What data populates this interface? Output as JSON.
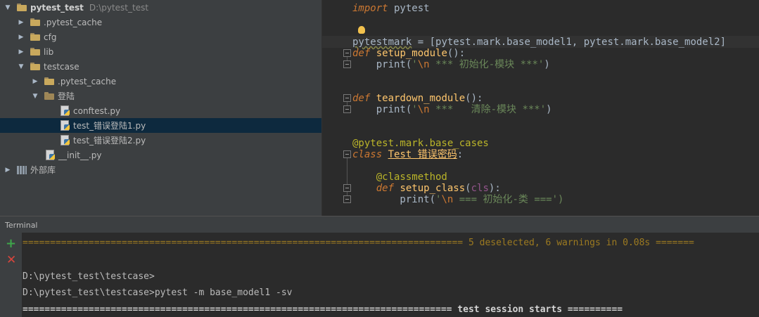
{
  "project_tree": {
    "root": {
      "name": "pytest_test",
      "path": "D:\\pytest_test"
    },
    "items": [
      {
        "label": ".pytest_cache"
      },
      {
        "label": "cfg"
      },
      {
        "label": "lib"
      },
      {
        "label": "testcase"
      },
      {
        "label": ".pytest_cache"
      },
      {
        "label": "登陆"
      },
      {
        "label": "conftest.py"
      },
      {
        "label": "test_错误登陆1.py"
      },
      {
        "label": "test_错误登陆2.py"
      },
      {
        "label": "__init__.py"
      },
      {
        "label": "外部库"
      }
    ]
  },
  "editor": {
    "lines": {
      "l1_kw": "import",
      "l1_rest": " pytest",
      "l3_a": "pytestmark",
      "l3_b": " = [pytest.mark.base_model1, pytest.mark.base_model2]",
      "l4_kw": "def",
      "l4_fn": " setup_module",
      "l4_rest": "():",
      "l5_a": "    print(",
      "l5_str_a": "'",
      "l5_esc": "\\n",
      "l5_str_b": " *** 初始化-模块 ***'",
      "l5_end": ")",
      "l8_kw": "def",
      "l8_fn": " teardown_module",
      "l8_rest": "():",
      "l9_a": "    print(",
      "l9_str_a": "'",
      "l9_esc": "\\n",
      "l9_str_b": " ***   清除-模块 ***'",
      "l9_end": ")",
      "l12_deco": "@pytest.mark.base_cases",
      "l13_kw": "class",
      "l13_sp": " ",
      "l13_cls": "Test 错误密码",
      "l13_rest": ":",
      "l15_deco": "    @classmethod",
      "l16_kw": "    def",
      "l16_fn": " setup_class",
      "l16_a": "(",
      "l16_self": "cls",
      "l16_b": "):",
      "l17_a": "        print(",
      "l17_str_a": "'",
      "l17_esc": "\\n",
      "l17_str_b": " === 初始化-类 ===')",
      "l17_end": ")"
    }
  },
  "terminal": {
    "title": "Terminal",
    "line1_eq": "================================================================================",
    "line1_summary": " 5 deselected, 6 warnings in 0.08s =======",
    "line2": "D:\\pytest_test\\testcase>",
    "line3": "D:\\pytest_test\\testcase>pytest -m base_model1 -sv",
    "line4_eq": "==============================================================================",
    "line4_title": " test session starts ",
    "line4_eq2": "=========="
  }
}
